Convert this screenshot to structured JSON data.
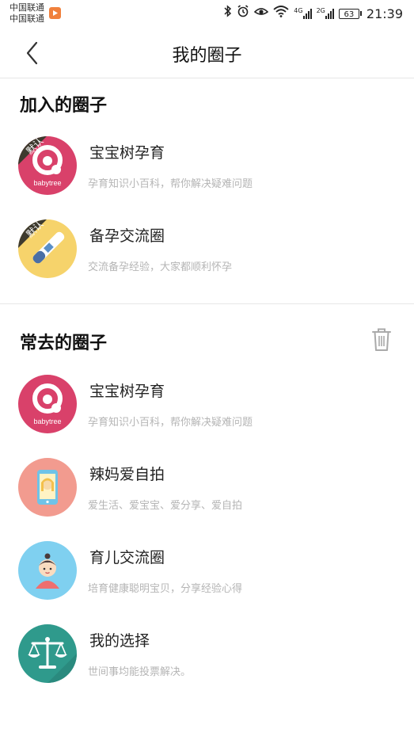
{
  "status_bar": {
    "carrier_1": "中国联通",
    "carrier_2": "中国联通",
    "network_1": "4G",
    "network_2": "2G",
    "battery": "63",
    "time": "21:39"
  },
  "header": {
    "title": "我的圈子"
  },
  "joined": {
    "title": "加入的圈子",
    "badge_label": "默认",
    "items": [
      {
        "name": "宝宝树孕育",
        "desc": "孕育知识小百科，帮你解决疑难问题",
        "icon": "babytree-logo-icon",
        "logo_text": "babytree",
        "color": "#d9416a"
      },
      {
        "name": "备孕交流圈",
        "desc": "交流备孕经验，大家都顺利怀孕",
        "icon": "pregnancy-test-icon",
        "color": "#f6d36b"
      }
    ]
  },
  "frequent": {
    "title": "常去的圈子",
    "items": [
      {
        "name": "宝宝树孕育",
        "desc": "孕育知识小百科，帮你解决疑难问题",
        "icon": "babytree-logo-icon",
        "logo_text": "babytree",
        "color": "#d9416a"
      },
      {
        "name": "辣妈爱自拍",
        "desc": "爱生活、爱宝宝、爱分享、爱自拍",
        "icon": "selfie-phone-icon",
        "color": "#f29b8f"
      },
      {
        "name": "育儿交流圈",
        "desc": "培育健康聪明宝贝，分享经验心得",
        "icon": "baby-face-icon",
        "color": "#7fd0f0"
      },
      {
        "name": "我的选择",
        "desc": "世间事均能投票解决。",
        "icon": "scales-icon",
        "color": "#2f9a8c"
      }
    ]
  },
  "colors": {
    "divider": "#e6e6e6",
    "desc_text": "#b5b5b5",
    "badge_dark": "#3d3a2e"
  }
}
